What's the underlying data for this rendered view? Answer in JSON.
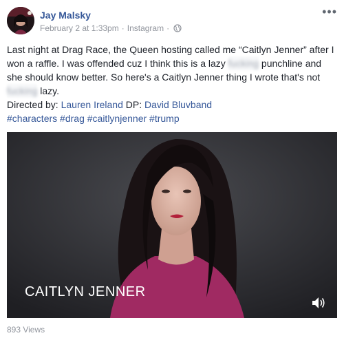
{
  "post": {
    "author": "Jay Malsky",
    "date": "February 2 at 1:33pm",
    "separator": "·",
    "source": "Instagram",
    "privacy_icon": "globe-icon",
    "more_icon": "more-options-icon",
    "more_glyph": "•••",
    "body": {
      "part1": "Last night at Drag Race, the Queen hosting called me “Caitlyn Jenner” after I won a raffle. I was offended cuz I think this is a lazy ",
      "blurred1": "fucking",
      "part2": " punchline and she should know better. So here's a Caitlyn Jenner thing I wrote that's not ",
      "blurred2": "fucking",
      "part3": " lazy."
    },
    "credits": {
      "directed_label": "Directed by: ",
      "director": "Lauren Ireland",
      "dp_label": " DP: ",
      "dp": "David Bluvband"
    },
    "hashtags": [
      "#characters",
      "#drag",
      "#caitlynjenner",
      "#trump"
    ],
    "video": {
      "caption": "CAITLYN JENNER",
      "volume_icon": "volume-icon"
    },
    "views": "893 Views"
  },
  "colors": {
    "link": "#365899",
    "meta": "#90949c",
    "text": "#1d2129",
    "video_bg": "#2a2a2e"
  }
}
